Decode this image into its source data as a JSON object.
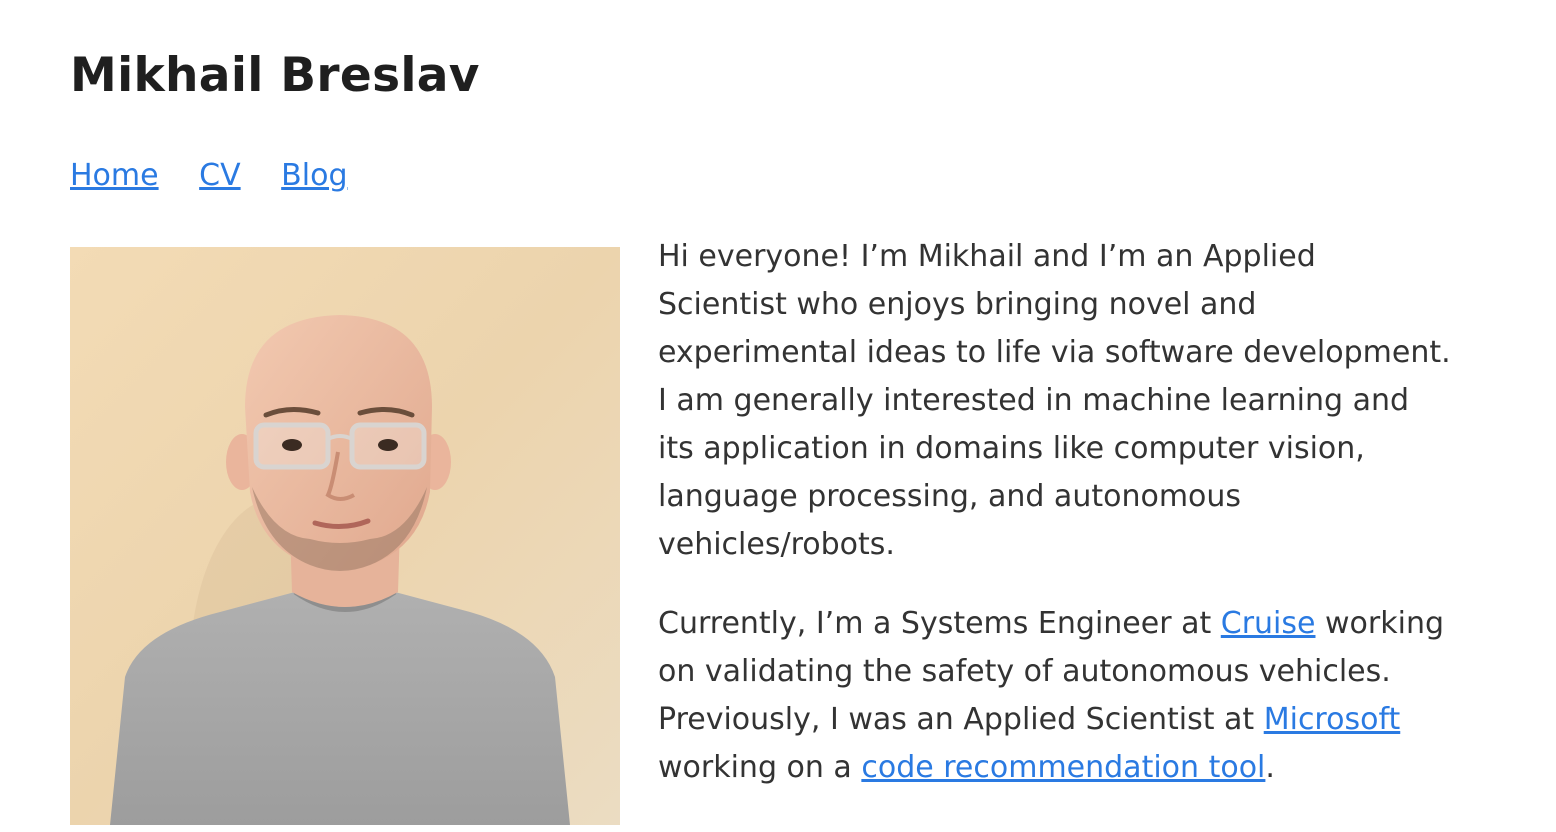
{
  "site": {
    "title": "Mikhail Breslav"
  },
  "nav": {
    "items": [
      {
        "label": "Home"
      },
      {
        "label": "CV"
      },
      {
        "label": "Blog"
      }
    ]
  },
  "profile_photo": {
    "alt": "Mikhail Breslav",
    "icon": "profile-photo"
  },
  "bio": {
    "intro_lines": [
      "Hi everyone! I’m Mikhail and I’m an Applied",
      "Scientist who enjoys bringing novel and",
      "experimental ideas to life via software development.",
      "I am generally interested in machine learning and",
      "its application in domains like computer vision,",
      "language processing, and autonomous",
      "vehicles/robots."
    ],
    "current": {
      "text_1": "Currently, I’m a Systems Engineer at ",
      "link_cruise": "Cruise",
      "text_2": " working",
      "line_2": "on validating the safety of autonomous vehicles.",
      "text_3": "Previously, I was an Applied Scientist at ",
      "link_microsoft": "Microsoft",
      "text_4": "working on a ",
      "link_tool": "code recommendation tool",
      "text_5": "."
    }
  },
  "colors": {
    "link": "#2a7ae2",
    "text": "#333333",
    "title": "#1f1f1f",
    "photo_background": "#f1d9b4",
    "shirt": "#a5a5a5"
  }
}
